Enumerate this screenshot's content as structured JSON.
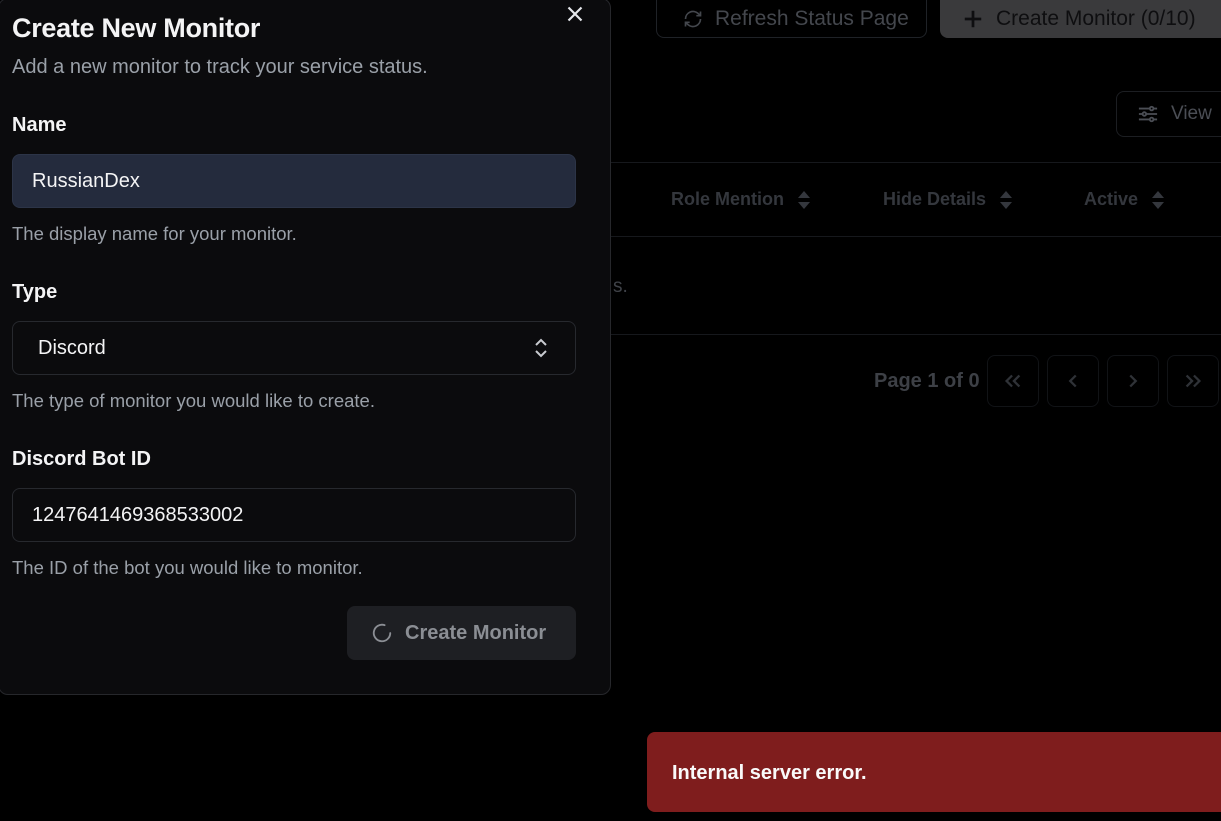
{
  "background": {
    "refresh_button": "Refresh Status Page",
    "create_button": "Create Monitor (0/10)",
    "view_button": "View",
    "columns": [
      "Role Mention",
      "Hide Details",
      "Active"
    ],
    "empty_partial": "s.",
    "pagination": {
      "label": "Page 1 of 0",
      "first": "«",
      "prev": "‹",
      "next": "›",
      "last": "»"
    }
  },
  "dialog": {
    "title": "Create New Monitor",
    "subtitle": "Add a new monitor to track your service status.",
    "name": {
      "label": "Name",
      "value": "RussianDex",
      "help": "The display name for your monitor."
    },
    "type": {
      "label": "Type",
      "value": "Discord",
      "help": "The type of monitor you would like to create."
    },
    "bot_id": {
      "label": "Discord Bot ID",
      "value": "1247641469368533002",
      "help": "The ID of the bot you would like to monitor."
    },
    "submit_label": "Create Monitor"
  },
  "toast": {
    "message": "Internal server error.",
    "color": "#7f1d1d"
  },
  "icons": {
    "close": "x-icon",
    "refresh": "refresh-icon",
    "plus": "plus-icon",
    "view": "sliders-icon",
    "sort": "sort-icon",
    "select": "chevrons-up-down-icon",
    "loading": "spinner-icon"
  }
}
